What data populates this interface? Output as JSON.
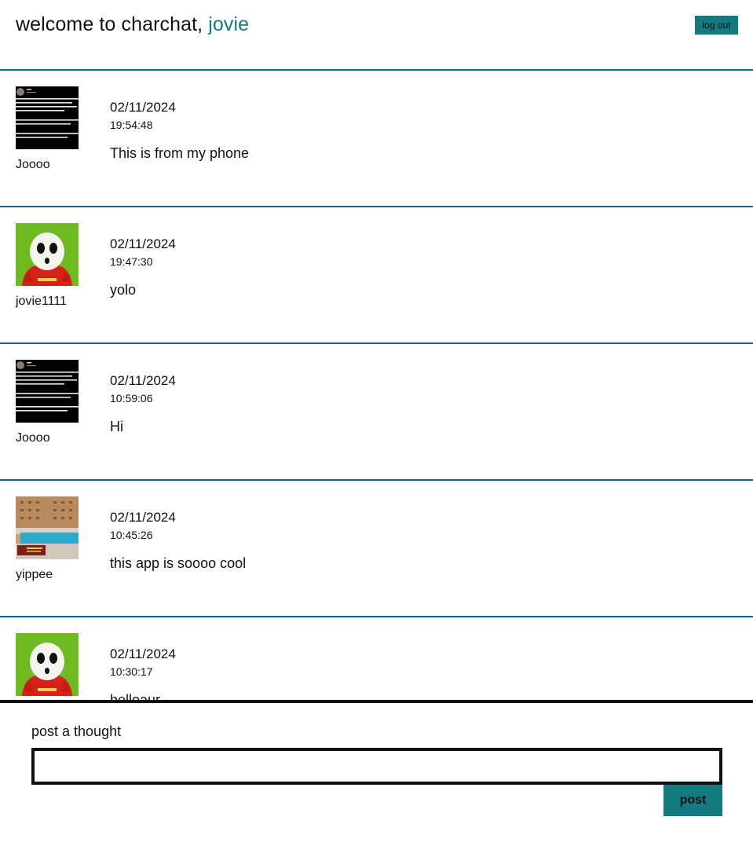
{
  "header": {
    "welcome_prefix": "welcome to charchat,",
    "username": "jovie",
    "logout_label": "log out"
  },
  "posts": [
    {
      "username": "Joooo",
      "avatar": "tweet-screenshot-avatar",
      "date": "02/11/2024",
      "time": "19:54:48",
      "message": "This is from my phone"
    },
    {
      "username": "jovie1111",
      "avatar": "shy-guy-avatar",
      "date": "02/11/2024",
      "time": "19:47:30",
      "message": "yolo"
    },
    {
      "username": "Joooo",
      "avatar": "tweet-screenshot-avatar",
      "date": "02/11/2024",
      "time": "10:59:06",
      "message": "Hi"
    },
    {
      "username": "yippee",
      "avatar": "pool-photo-avatar",
      "date": "02/11/2024",
      "time": "10:45:26",
      "message": "this app is soooo cool"
    },
    {
      "username": "",
      "avatar": "shy-guy-avatar",
      "date": "02/11/2024",
      "time": "10:30:17",
      "message": "helloaur"
    }
  ],
  "composer": {
    "label": "post a thought",
    "input_value": "",
    "post_label": "post"
  },
  "colors": {
    "accent": "#137b80",
    "divider": "#0b6a86",
    "text": "#111111"
  }
}
